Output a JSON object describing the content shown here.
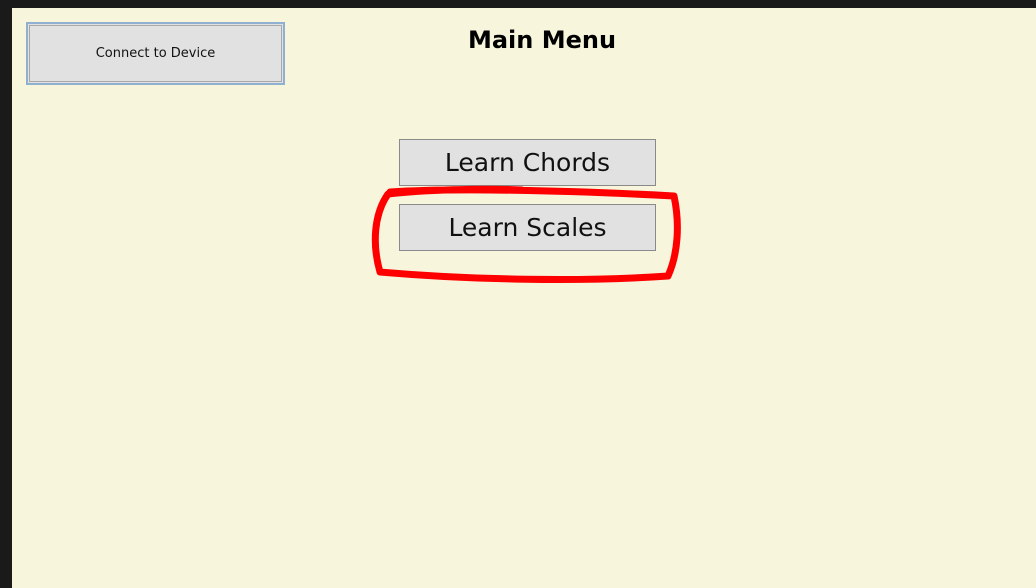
{
  "connect_button": {
    "label": "Connect to Device"
  },
  "header": {
    "title": "Main Menu"
  },
  "menu": {
    "items": [
      {
        "label": "Learn Chords"
      },
      {
        "label": "Learn Scales"
      }
    ]
  },
  "annotation": {
    "type": "red-hand-drawn-circle",
    "target": "Learn Scales",
    "color": "#ff0000"
  },
  "colors": {
    "background": "#f7f6dd",
    "button": "#e1e1e1",
    "window_border": "#1a1a1a"
  }
}
